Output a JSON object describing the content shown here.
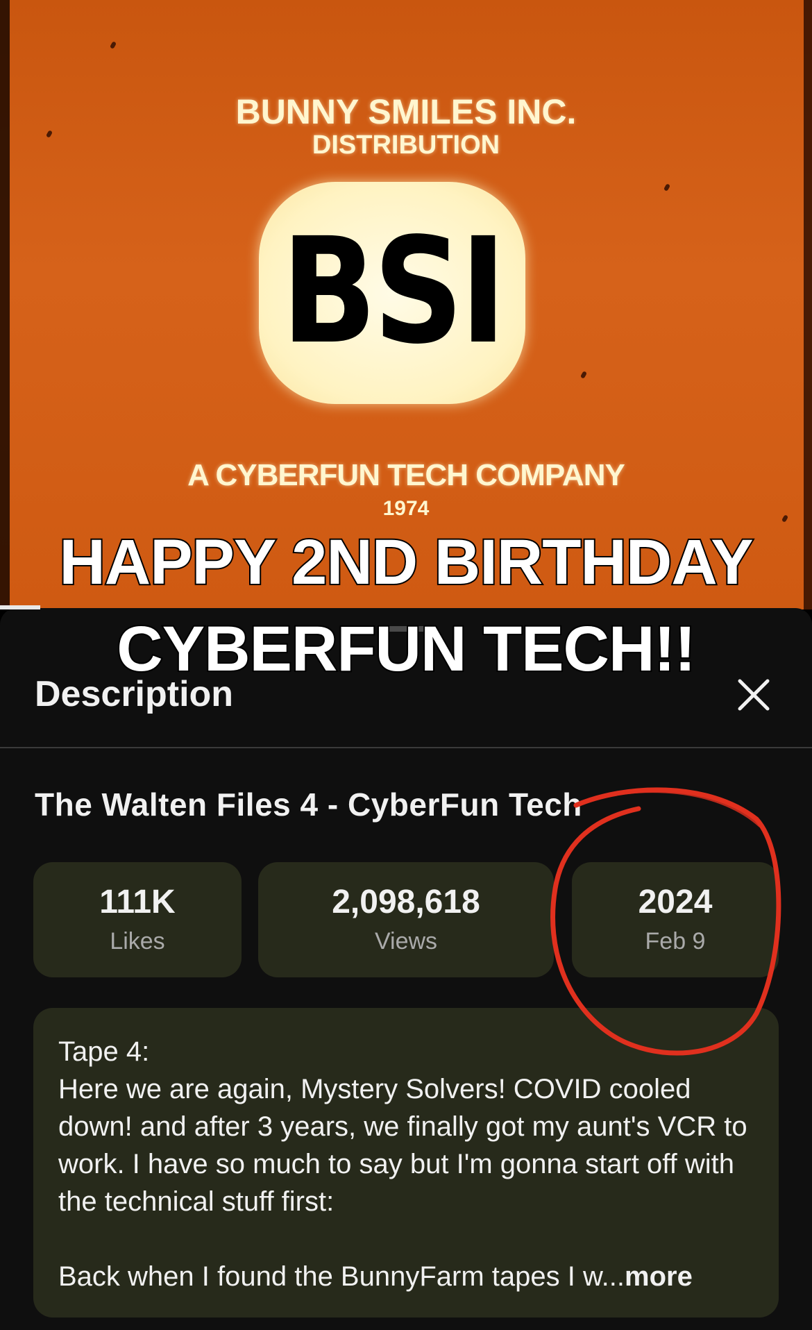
{
  "video": {
    "logo": {
      "company": "BUNNY SMILES INC.",
      "subtitle": "DISTRIBUTION",
      "letters": "BSI",
      "tagline": "A CYBERFUN TECH COMPANY",
      "year": "1974"
    },
    "caption_line1": "HAPPY 2ND BIRTHDAY",
    "caption_line2": "CYBERFUN TECH!!",
    "progress_fraction": 0.05
  },
  "sheet": {
    "title": "Description",
    "close_icon": "close-icon",
    "video_title": "The Walten Files 4 - CyberFun Tech",
    "stats": [
      {
        "value": "111K",
        "label": "Likes"
      },
      {
        "value": "2,098,618",
        "label": "Views"
      },
      {
        "value": "2024",
        "label": "Feb 9"
      }
    ],
    "description": {
      "text": "Tape 4:\nHere we are again, Mystery Solvers! COVID cooled down! and after 3 years, we finally got my aunt's VCR to work. I have so much to say but I'm gonna start off with the technical stuff first:\n\nBack when I found the BunnyFarm tapes I w...",
      "more_label": "more"
    },
    "annotation_color": "#e0301e"
  }
}
